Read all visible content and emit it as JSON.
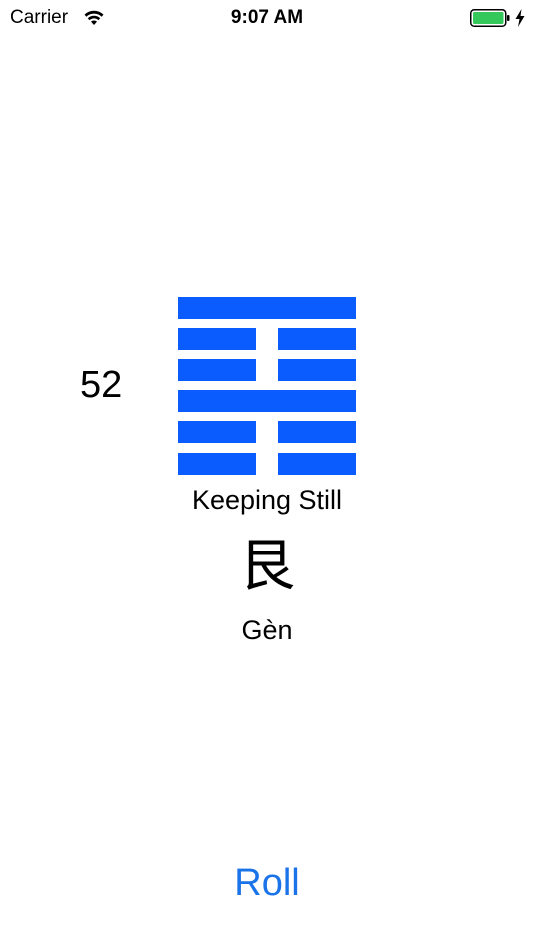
{
  "status_bar": {
    "carrier": "Carrier",
    "time": "9:07 AM",
    "icons": [
      "wifi-icon",
      "battery-icon",
      "charging-icon"
    ],
    "battery_color": "#34c759"
  },
  "hexagram": {
    "number": "52",
    "lines_top_to_bottom": [
      "yang",
      "yin",
      "yin",
      "yang",
      "yin",
      "yin"
    ],
    "line_color": "#0a5cff",
    "english_name": "Keeping Still",
    "chinese": "艮",
    "pinyin": "Gèn"
  },
  "actions": {
    "roll_label": "Roll",
    "accent_color": "#1a73e8"
  }
}
